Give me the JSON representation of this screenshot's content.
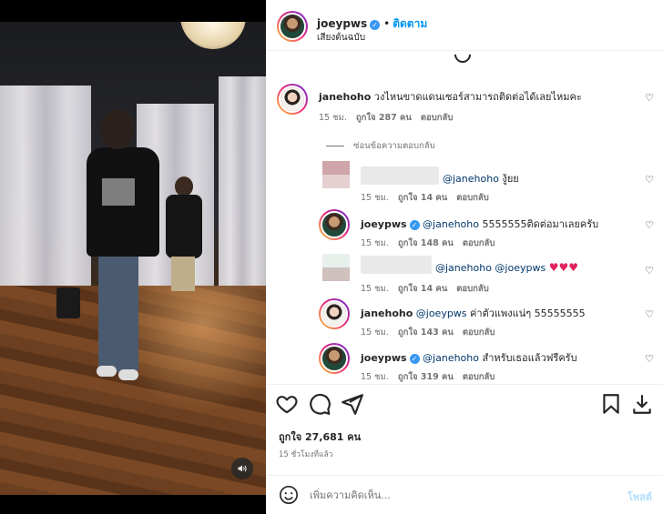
{
  "header": {
    "username": "joeypws",
    "dot": "•",
    "follow_label": "ติดตาม",
    "subtitle": "เสียงต้นฉบับ",
    "more": "···"
  },
  "comments": {
    "main": {
      "username": "janehoho",
      "text": "วงไหนขาดแดนเซอร์สามารถติดต่อได้เลยไหมคะ",
      "time": "15 ชม.",
      "likes": "ถูกใจ 287 คน",
      "reply": "ตอบกลับ"
    },
    "hide_replies": "ซ่อนข้อความตอบกลับ",
    "replies": [
      {
        "mention": "@janehoho",
        "text": " งู้ยย",
        "time": "15 ชม.",
        "likes": "ถูกใจ 14 คน",
        "reply": "ตอบกลับ"
      },
      {
        "username": "joeypws",
        "mention": "@janehoho",
        "text": " 5555555ติดต่อมาเลยครับ",
        "time": "15 ชม.",
        "likes": "ถูกใจ 148 คน",
        "reply": "ตอบกลับ"
      },
      {
        "mention": "@janehoho @joeypws",
        "hearts": "♥♥♥",
        "time": "15 ชม.",
        "likes": "ถูกใจ 14 คน",
        "reply": "ตอบกลับ"
      },
      {
        "username": "janehoho",
        "mention": "@joeypws",
        "text": " ค่าตัวแพงแน่ๆ 55555555",
        "time": "15 ชม.",
        "likes": "ถูกใจ 143 คน",
        "reply": "ตอบกลับ"
      },
      {
        "username": "joeypws",
        "mention": "@janehoho",
        "text": " สำหรับเธอแล้วฟรีครับ",
        "time": "15 ชม.",
        "likes": "ถูกใจ 319 คน",
        "reply": "ตอบกลับ"
      }
    ]
  },
  "footer": {
    "likes": "ถูกใจ 27,681 คน",
    "time": "15 ชั่วโมงที่แล้ว",
    "comment_placeholder": "เพิ่มความคิดเห็น...",
    "post_label": "โพสต์"
  },
  "icons": {
    "heart": "heart-icon",
    "comment": "comment-icon",
    "share": "share-icon",
    "save": "bookmark-icon",
    "download": "download-icon",
    "emoji": "emoji-icon",
    "mute": "speaker-icon"
  },
  "colors": {
    "link_blue": "#0095f6",
    "mention": "#00376b",
    "verified": "#3897f0",
    "red_heart": "#e0245e"
  }
}
